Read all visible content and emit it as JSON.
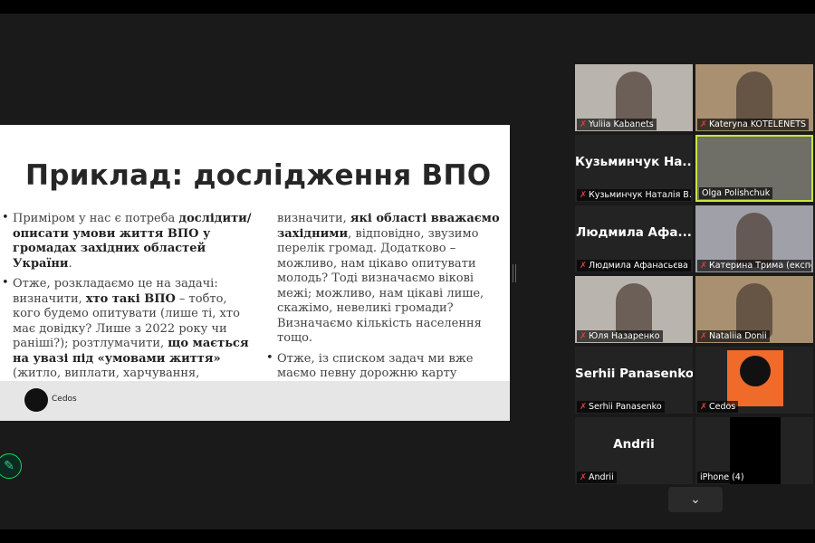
{
  "slide": {
    "title": "Приклад: дослідження ВПО",
    "left": [
      {
        "a": "Приміром у нас є потреба ",
        "b": "дослідити/ описати умови життя ВПО у громадах західних областей України",
        "c": "."
      },
      {
        "a": "Отже, розкладаємо це на задачі: визначити, ",
        "b": "хто такі ВПО",
        "c": " – тобто, кого будемо опитувати (лише ті, хто має довідку? Лише з 2022 року чи раніші?); розтлумачити, ",
        "d": "що мається на увазі під «умовами життя»",
        "e": " (житло, виплати, харчування, зайнятість, …?);"
      }
    ],
    "right": [
      {
        "a": "визначити, ",
        "b": "які області вважаємо західними",
        "c": ", відповідно, звузимо перелік громад. Додатково – можливо, нам цікаво опитувати молодь? Тоді визначаємо вікові межі; можливо, нам цікаві лише, скажімо, невеликі громади? Визначаємо кількість населення тощо."
      },
      {
        "a": "Отже, із списком задач ми вже маємо певну дорожню карту дослідження – розуміємо,  кого і про що опитуємо"
      }
    ],
    "footer_logo": "Cedos"
  },
  "participants": [
    {
      "name": "Yuliia Kabanets",
      "video": true
    },
    {
      "name": "Kateryna KOTELENETS",
      "video": true
    },
    {
      "name": "Кузьминчук Наталія В...",
      "big": "Кузьминчук  На...",
      "video": false
    },
    {
      "name": "Olga Polishchuk",
      "video": true,
      "active": true
    },
    {
      "name": "Людмила Афанасьєва",
      "big": "Людмила  Афа...",
      "video": false
    },
    {
      "name": "Катерина Трима (експерт...",
      "video": true
    },
    {
      "name": "Юля Назаренко",
      "video": true
    },
    {
      "name": "Nataliia Donii",
      "video": true
    },
    {
      "name": "Serhii Panasenko",
      "big": "Serhii Panasenko",
      "video": false
    },
    {
      "name": "Cedos",
      "big": "Cedos",
      "video": false
    },
    {
      "name": "Andrii",
      "big": "Andrii",
      "video": false
    },
    {
      "name": "iPhone (4)",
      "video": false
    }
  ],
  "icons": {
    "muted": "✗",
    "chevron": "⌄",
    "pen": "✎"
  }
}
